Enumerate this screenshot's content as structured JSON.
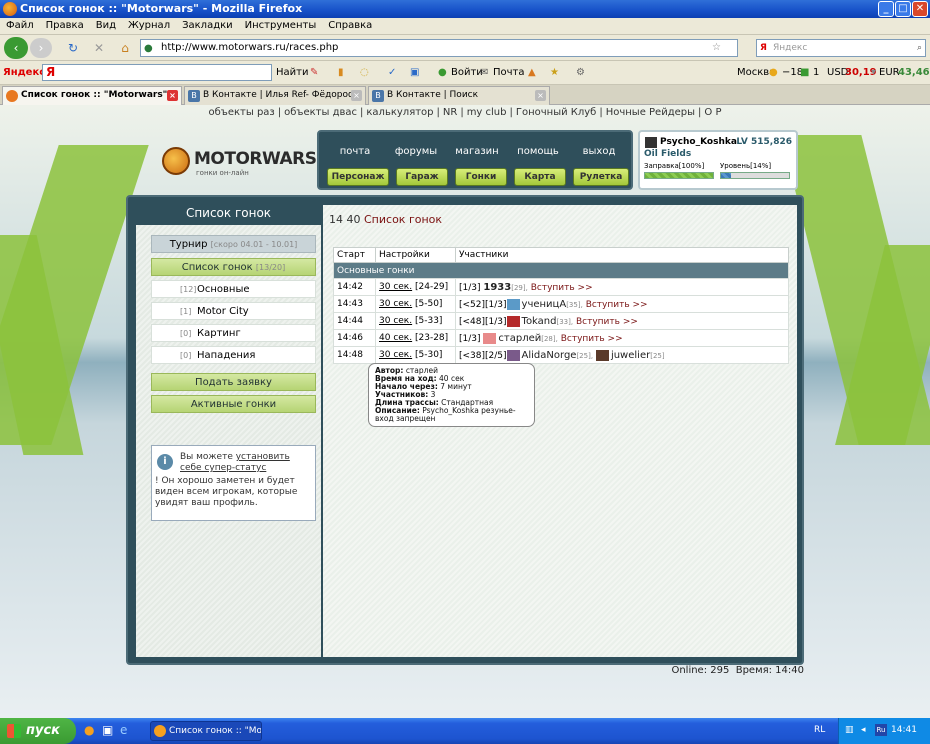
{
  "window": {
    "title": "Список гонок :: \"Motorwars\" - Mozilla Firefox"
  },
  "menu": [
    "Файл",
    "Правка",
    "Вид",
    "Журнал",
    "Закладки",
    "Инструменты",
    "Справка"
  ],
  "nav": {
    "url": "http://www.motorwars.ru/races.php",
    "search_placeholder": "Яндекс"
  },
  "ybar": {
    "brand": "Яндекс",
    "find": "Найти",
    "login": "Войти",
    "mail": "Почта",
    "city": "Москва",
    "temp": "−18",
    "one": "1",
    "usd_label": "USD",
    "usd": "30,19",
    "eur_label": "EUR",
    "eur": "43,46"
  },
  "tabs": [
    {
      "label": "Список гонок :: \"Motorwars\""
    },
    {
      "label": "В Контакте | Илья Ref- Фёдороф"
    },
    {
      "label": "В Контакте | Поиск"
    }
  ],
  "toplinks": [
    "объекты раз",
    "объекты двас",
    "калькулятор",
    "NR",
    "my club",
    "Гоночный Клуб",
    "Ночные Рейдеры",
    "О Р"
  ],
  "logo": {
    "text": "MOTORWARS.RU",
    "sub": "гонки он-лайн"
  },
  "topnav": [
    "почта",
    "форумы",
    "магазин",
    "помощь",
    "выход"
  ],
  "greennav": [
    "Персонаж",
    "Гараж",
    "Гонки",
    "Карта",
    "Рулетка"
  ],
  "player": {
    "name": "Psycho_Koshka",
    "level": "LV 515,826",
    "city": "Oil Fields",
    "fuel_label": "Заправка[100%]",
    "fuel_value": 1.0,
    "level_label": "Уровень[14%]",
    "level_value": 0.14
  },
  "left": {
    "header": "Список гонок",
    "tournament": "Турнир",
    "tournament_note": "[скоро 04.01 - 10.01]",
    "racelist": "Список гонок",
    "racelist_count": "[13/20]",
    "items": [
      {
        "count": "[12]",
        "label": "Основные"
      },
      {
        "count": "[1]",
        "label": "Motor City"
      },
      {
        "count": "[0]",
        "label": "Картинг"
      },
      {
        "count": "[0]",
        "label": "Нападения"
      }
    ],
    "submit": "Подать заявку",
    "active": "Активные гонки",
    "info_pre": "Вы можете ",
    "info_link": "установить себе супер-статус",
    "info_post": "! Он хорошо заметен и будет виден всем игрокам, которые увидят ваш профиль."
  },
  "main": {
    "time": "14 40",
    "title": "Список гонок",
    "columns": [
      "Старт",
      "Настройки",
      "Участники"
    ],
    "section": "Основные гонки",
    "rows": [
      {
        "start": "14:42",
        "setting_link": "30 сек.",
        "setting_range": "[24-29]",
        "prefix": "[1/3]",
        "player": "1933",
        "plevel": "[29],",
        "join": "Вступить >>"
      },
      {
        "start": "14:43",
        "setting_link": "30 сек.",
        "setting_range": "[5-50]",
        "prefix": "[<52][1/3]",
        "player": "ученицА",
        "plevel": "[35],",
        "join": "Вступить >>"
      },
      {
        "start": "14:44",
        "setting_link": "30 сек.",
        "setting_range": "[5-33]",
        "prefix": "[<48][1/3]",
        "player": "Tokand",
        "plevel": "[33],",
        "join": "Вступить >>"
      },
      {
        "start": "14:46",
        "setting_link": "40 сек.",
        "setting_range": "[23-28]",
        "prefix": "[1/3]",
        "player": "старлей",
        "plevel": "[28],",
        "join": "Вступить >>"
      },
      {
        "start": "14:48",
        "setting_link": "30 сек.",
        "setting_range": "[5-30]",
        "prefix": "[<38][2/5]",
        "player": "AlidaNorge",
        "plevel": "[25],",
        "player2": "juwelier",
        "plevel2": "[25]",
        "join": ""
      }
    ]
  },
  "tooltip": {
    "author_l": "Автор:",
    "author": "старлей",
    "turn_l": "Время на ход:",
    "turn": "40 сек",
    "start_l": "Начало через:",
    "start": "7 минут",
    "members_l": "Участников:",
    "members": "3",
    "track_l": "Длина трассы:",
    "track": "Стандартная",
    "desc_l": "Описание:",
    "desc": "Psycho_Koshka резунье-вход запрещен"
  },
  "footer": {
    "online": "Online: 295",
    "time": "Время: 14:40"
  },
  "taskbar": {
    "start": "пуск",
    "item": "Список гонок :: \"Mot...",
    "lang": "RL",
    "clock": "14:41"
  }
}
